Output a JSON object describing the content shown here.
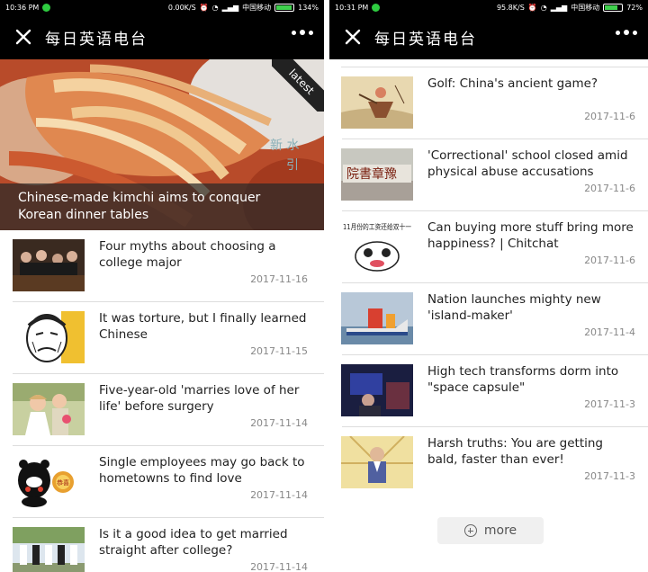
{
  "left": {
    "status": {
      "time": "10:36 PM",
      "net": "0.00K/S",
      "carrier": "中国移动",
      "battery_pct": "134%"
    },
    "nav": {
      "title": "每日英语电台"
    },
    "hero": {
      "ribbon": "latest",
      "caption": "Chinese-made kimchi aims to conquer Korean dinner tables"
    },
    "items": [
      {
        "title": "Four myths about choosing a college major",
        "date": "2017-11-16"
      },
      {
        "title": "It was torture, but I finally learned Chinese",
        "date": "2017-11-15"
      },
      {
        "title": "Five-year-old 'marries love of her life' before surgery",
        "date": "2017-11-14"
      },
      {
        "title": "Single employees may go back to hometowns to find love",
        "date": "2017-11-14"
      },
      {
        "title": "Is it a good idea to get married straight after college?",
        "date": "2017-11-14"
      }
    ]
  },
  "right": {
    "status": {
      "time": "10:31 PM",
      "net": "95.8K/S",
      "carrier": "中国移动",
      "battery": "72%"
    },
    "nav": {
      "title": "每日英语电台"
    },
    "items": [
      {
        "title": "Golf: China's ancient game?",
        "date": "2017-11-6"
      },
      {
        "title": "'Correctional' school closed amid physical abuse accusations",
        "date": "2017-11-6"
      },
      {
        "title": "Can buying more stuff bring more happiness? | Chitchat",
        "date": "2017-11-6",
        "thumb_text": "11月份的工资还给双十一"
      },
      {
        "title": "Nation launches mighty new 'island-maker'",
        "date": "2017-11-4"
      },
      {
        "title": "High tech transforms dorm into \"space capsule\"",
        "date": "2017-11-3"
      },
      {
        "title": "Harsh truths: You are getting bald, faster than ever!",
        "date": "2017-11-3"
      }
    ],
    "more_label": "more"
  }
}
